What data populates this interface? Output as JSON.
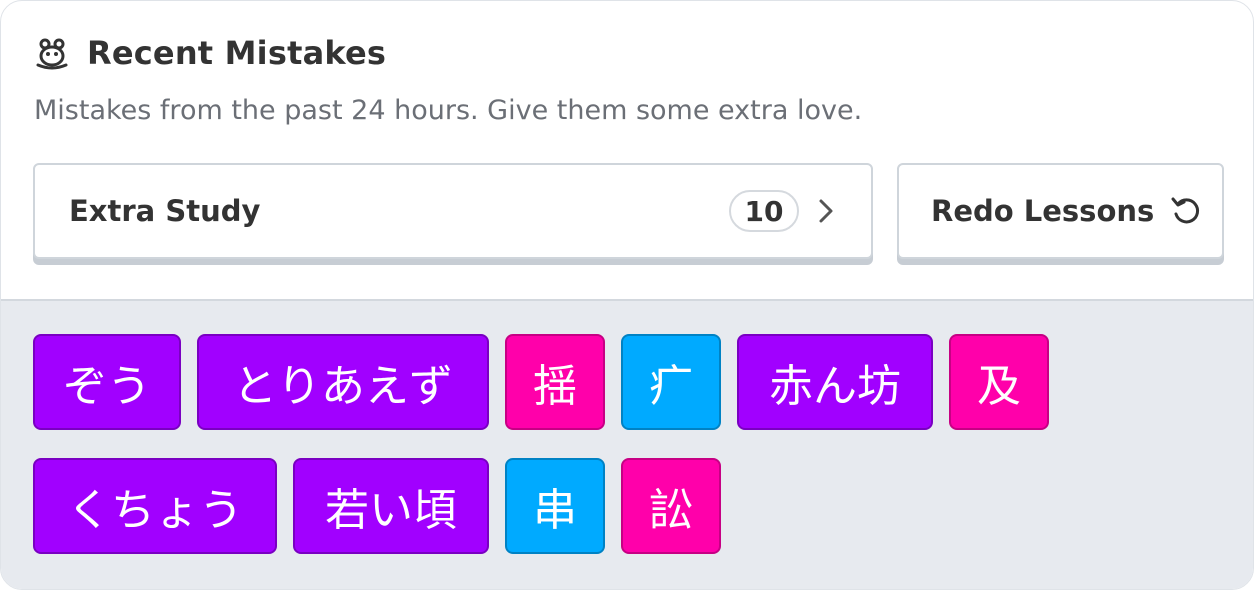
{
  "header": {
    "icon": "crabigator-icon",
    "title": "Recent Mistakes"
  },
  "subtitle": "Mistakes from the past 24 hours. Give them some extra love.",
  "extra_study": {
    "label": "Extra Study",
    "count": "10",
    "icon": "chevron-right-icon"
  },
  "redo_lessons": {
    "label": "Redo Lessons",
    "icon": "undo-icon"
  },
  "colors": {
    "vocabulary": "#a100ff",
    "kanji": "#ff00aa",
    "radical": "#00aaff",
    "lower_background": "#e7eaef"
  },
  "items": [
    {
      "text": "ぞう",
      "type": "vocabulary"
    },
    {
      "text": "とりあえず",
      "type": "vocabulary"
    },
    {
      "text": "揺",
      "type": "kanji"
    },
    {
      "text": "疒",
      "type": "radical"
    },
    {
      "text": "赤ん坊",
      "type": "vocabulary"
    },
    {
      "text": "及",
      "type": "kanji"
    },
    {
      "text": "くちょう",
      "type": "vocabulary"
    },
    {
      "text": "若い頃",
      "type": "vocabulary"
    },
    {
      "text": "串",
      "type": "radical"
    },
    {
      "text": "訟",
      "type": "kanji"
    }
  ]
}
